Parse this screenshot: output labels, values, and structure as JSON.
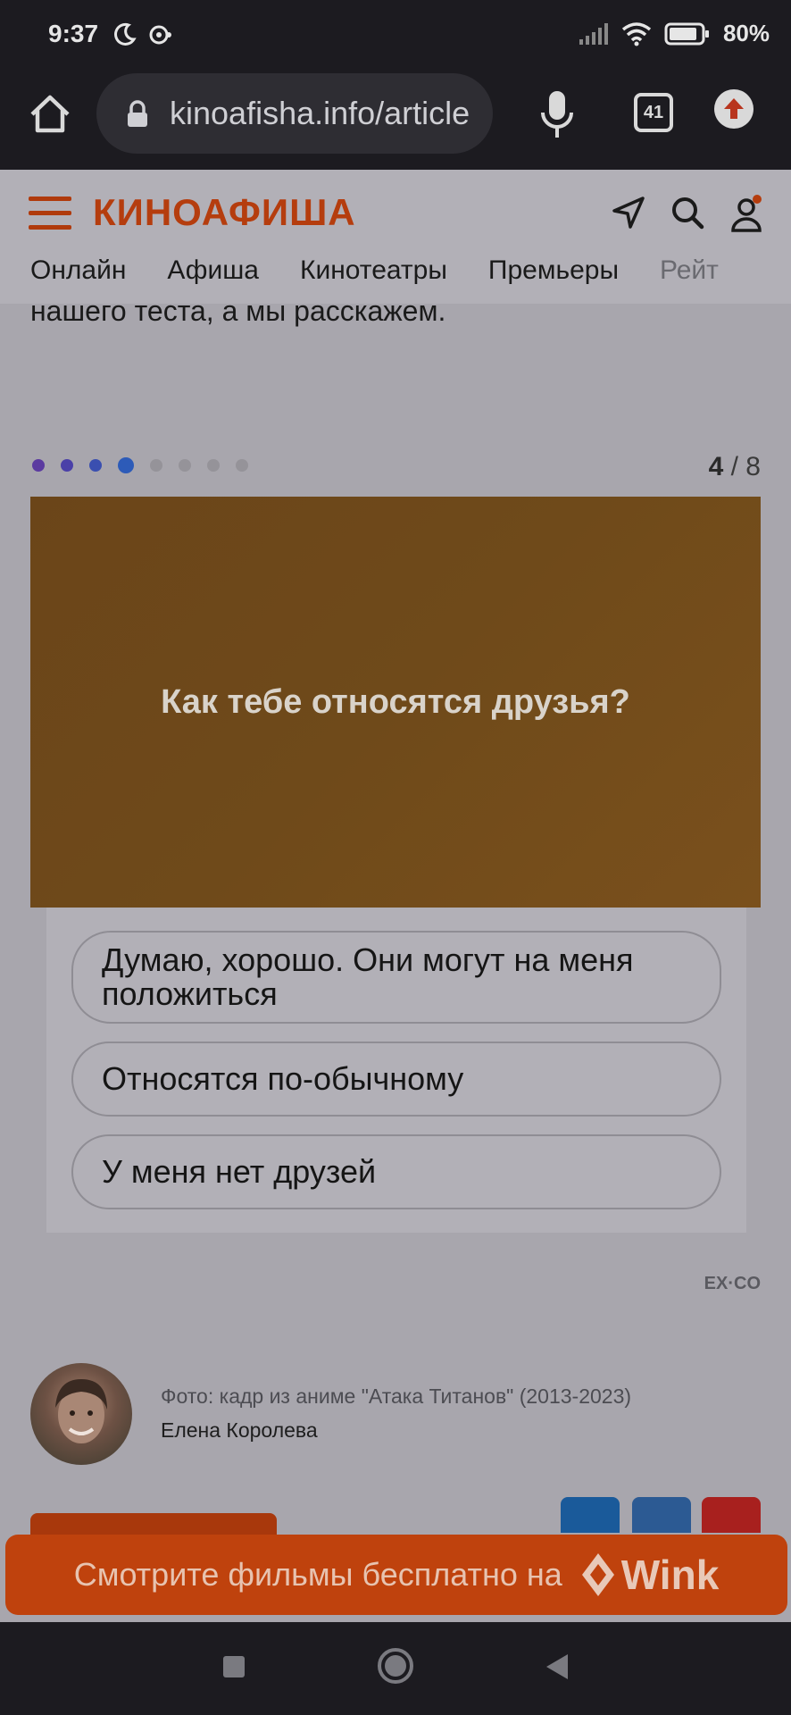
{
  "status_bar": {
    "time": "9:37",
    "battery": "80%",
    "icons": [
      "moon-icon",
      "vpn-icon",
      "signal-icon",
      "wifi-icon",
      "battery-icon"
    ]
  },
  "browser": {
    "url": "kinoafisha.info/article",
    "tabs_count": "41"
  },
  "site": {
    "logo": "КИНОАФИША",
    "nav": [
      "Онлайн",
      "Афиша",
      "Кинотеатры",
      "Премьеры",
      "Рейт"
    ]
  },
  "article": {
    "intro_text": "нашего теста, а мы расскажем."
  },
  "quiz": {
    "current": "4",
    "total": "/ 8",
    "question": "Как тебе относятся друзья?",
    "answers": [
      "Думаю, хорошо. Они могут на меня положиться",
      "Относятся по-обычному",
      "У меня нет друзей"
    ],
    "provider": "EX·CO",
    "dot_colors": [
      "#5b3aa0",
      "#4a40a8",
      "#3a4fb0",
      "#2d5bb8",
      "#959399",
      "#959399",
      "#959399",
      "#959399"
    ]
  },
  "author": {
    "photo_caption": "Фото: кадр из аниме \"Атака Титанов\" (2013-2023)",
    "name": "Елена Королева"
  },
  "banner": {
    "text": "Смотрите фильмы бесплатно на",
    "brand": "Wink"
  }
}
